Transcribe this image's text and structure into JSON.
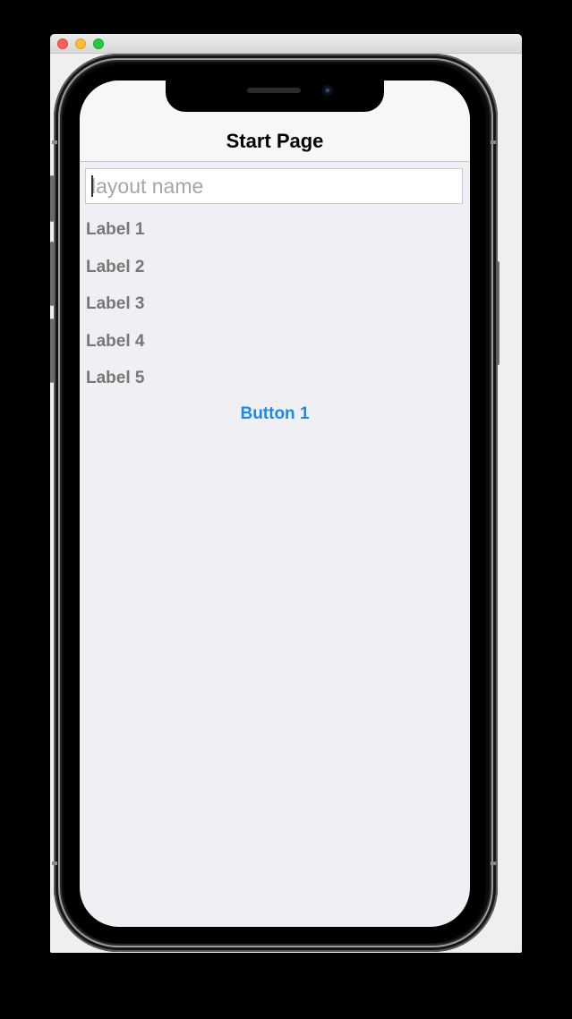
{
  "window": {
    "controls": [
      "close-button",
      "minimize-button",
      "zoom-button"
    ]
  },
  "navbar": {
    "title": "Start Page"
  },
  "form": {
    "input_placeholder": "layout name",
    "input_value": "",
    "labels": [
      "Label 1",
      "Label 2",
      "Label 3",
      "Label 4",
      "Label 5"
    ],
    "button_label": "Button 1"
  },
  "colors": {
    "accent": "#1a8ae8",
    "label_text": "#777777",
    "screen_background": "#efeff4",
    "navbar_background": "#f7f7f7"
  }
}
